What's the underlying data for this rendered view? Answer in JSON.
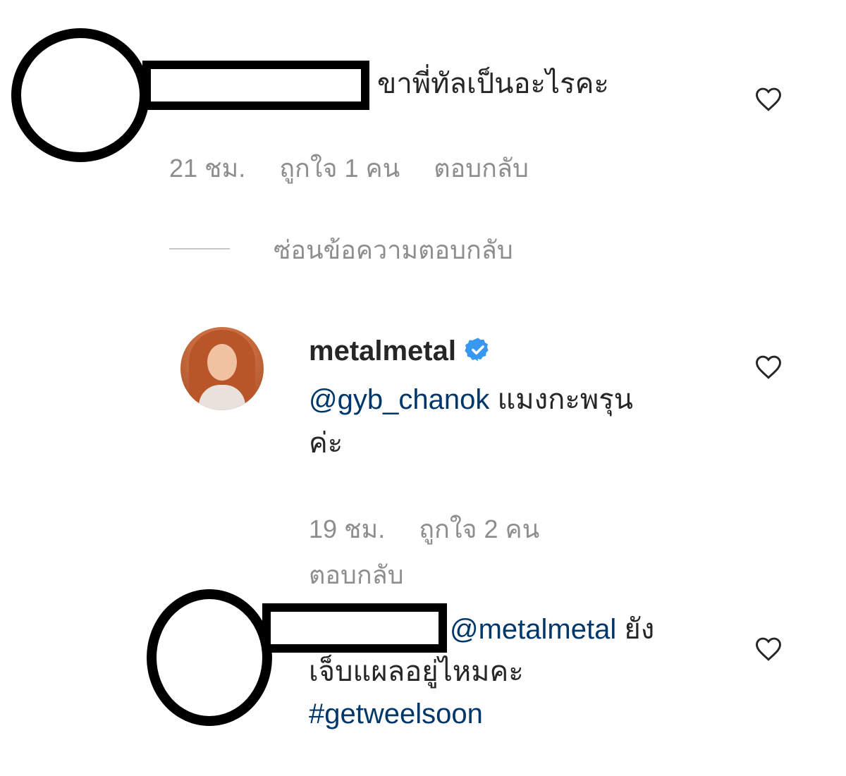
{
  "comment1": {
    "text": "ขาพี่ทัลเป็นอะไรคะ",
    "time": "21 ชม.",
    "likes": "ถูกใจ 1 คน",
    "reply": "ตอบกลับ"
  },
  "hide_replies": "ซ่อนข้อความตอบกลับ",
  "reply1": {
    "username": "metalmetal",
    "mention": "@gyb_chanok",
    "text_line1": " แมงกะพรุน",
    "text_line2": "ค่ะ",
    "time": "19 ชม.",
    "likes": "ถูกใจ 2 คน",
    "reply": "ตอบกลับ"
  },
  "reply2": {
    "mention": "@metalmetal",
    "text_line1": " ยัง",
    "text_line2": "เจ็บแผลอยู่ไหมคะ",
    "hashtag": "#getweelsoon"
  },
  "icons": {
    "heart": "heart-outline-icon",
    "verified": "verified-badge-icon"
  },
  "colors": {
    "link": "#00376b",
    "meta": "#8e8e8e",
    "verified": "#3897f0"
  }
}
